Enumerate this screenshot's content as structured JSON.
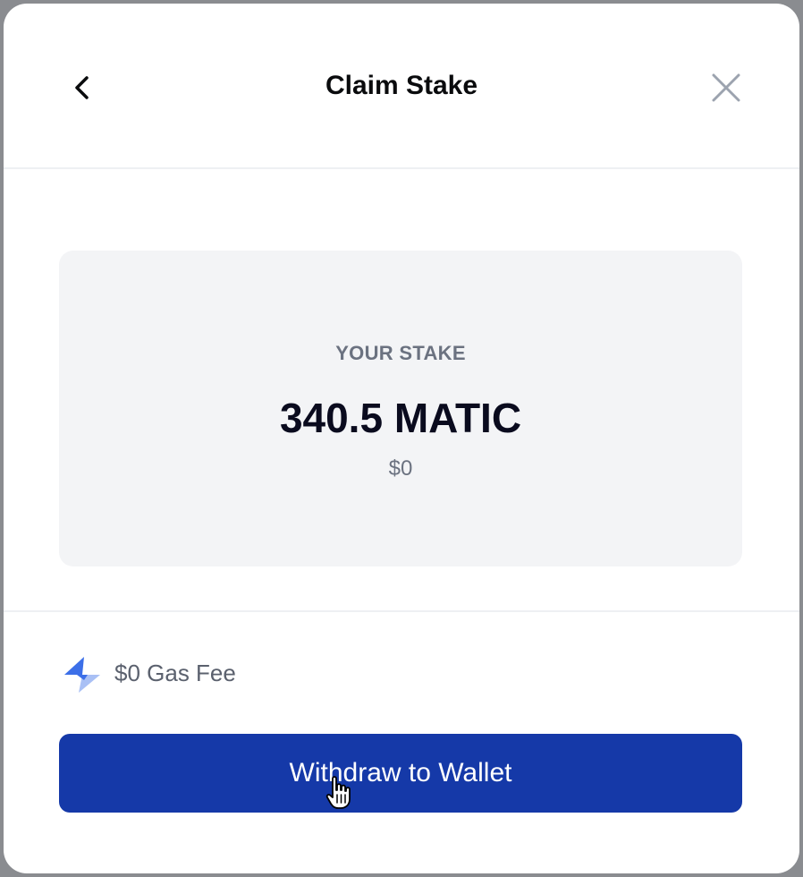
{
  "header": {
    "title": "Claim Stake",
    "back_icon": "chevron-left-icon",
    "close_icon": "close-icon"
  },
  "stake": {
    "label": "YOUR STAKE",
    "amount": "340.5 MATIC",
    "fiat": "$0"
  },
  "gas": {
    "icon": "lightning-icon",
    "text": "$0 Gas Fee"
  },
  "actions": {
    "withdraw_label": "Withdraw to Wallet"
  },
  "colors": {
    "primary": "#1539a8",
    "gas_icon": "#3c6fe8",
    "card_bg": "#f3f4f6"
  }
}
